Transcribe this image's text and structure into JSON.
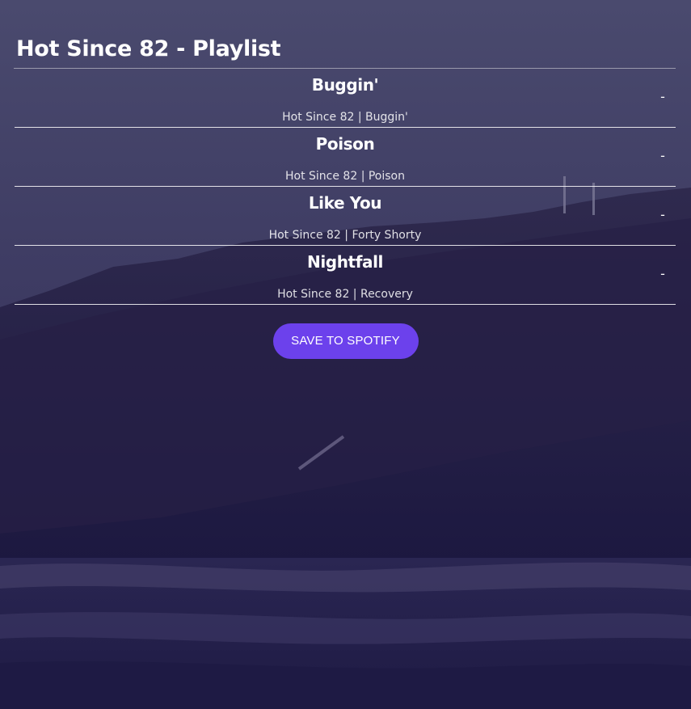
{
  "playlist": {
    "title": "Hot Since 82 - Playlist",
    "remove_label": "-",
    "tracks": [
      {
        "name": "Buggin'",
        "info": "Hot Since 82 | Buggin'"
      },
      {
        "name": "Poison",
        "info": "Hot Since 82 | Poison"
      },
      {
        "name": "Like You",
        "info": "Hot Since 82 | Forty Shorty"
      },
      {
        "name": "Nightfall",
        "info": "Hot Since 82 | Recovery"
      }
    ]
  },
  "actions": {
    "save_label": "SAVE TO SPOTIFY"
  },
  "colors": {
    "accent": "#6c41ec",
    "overlay": "#2a2650"
  }
}
